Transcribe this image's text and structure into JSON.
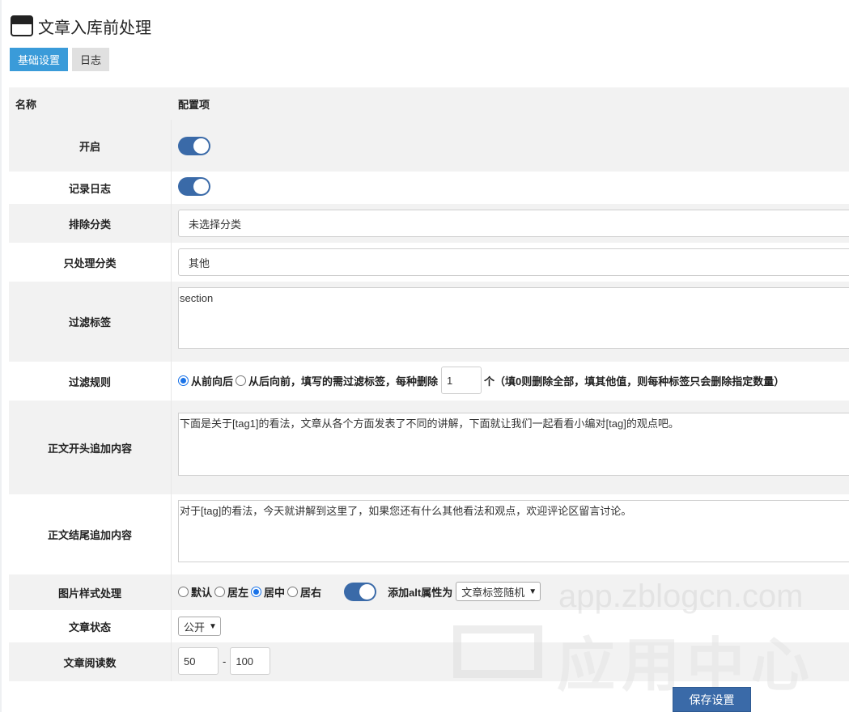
{
  "page": {
    "title": "文章入库前处理",
    "title_icon": "window-icon"
  },
  "tabs": [
    {
      "label": "基础设置",
      "active": true
    },
    {
      "label": "日志",
      "active": false
    }
  ],
  "table": {
    "col_name": "名称",
    "col_value": "配置项",
    "enable": {
      "label": "开启",
      "on": true
    },
    "log": {
      "label": "记录日志",
      "on": true
    },
    "exclude_category": {
      "label": "排除分类",
      "value": "未选择分类"
    },
    "only_category": {
      "label": "只处理分类",
      "value": "其他"
    },
    "filter_tags": {
      "label": "过滤标签",
      "value": "section"
    },
    "filter_rule": {
      "label": "过滤规则",
      "opt_front": "从前向后",
      "opt_back": "从后向前",
      "text_before": "，填写的需过滤标签，每种删除",
      "count": "1",
      "text_after": "个（填0则删除全部，填其他值，则每种标签只会删除指定数量）"
    },
    "prepend": {
      "label": "正文开头追加内容",
      "value": "下面是关于[tag1]的看法，文章从各个方面发表了不同的讲解，下面就让我们一起看看小编对[tag]的观点吧。"
    },
    "append": {
      "label": "正文结尾追加内容",
      "value": "对于[tag]的看法，今天就讲解到这里了，如果您还有什么其他看法和观点，欢迎评论区留言讨论。"
    },
    "image_style": {
      "label": "图片样式处理",
      "opt_default": "默认",
      "opt_left": "居左",
      "opt_center": "居中",
      "opt_right": "居右",
      "selected": "居中",
      "alt_on": true,
      "alt_label": "添加alt属性为",
      "alt_select": "文章标签随机"
    },
    "status": {
      "label": "文章状态",
      "value": "公开"
    },
    "views": {
      "label": "文章阅读数",
      "min": "50",
      "sep": "-",
      "max": "100"
    }
  },
  "save_label": "保存设置",
  "watermark": {
    "url": "app.zblogcn.com",
    "cn": "应用中心"
  },
  "colors": {
    "accent": "#3a9bd9",
    "switch": "#3a6aa8",
    "row_gray": "#f2f2f2"
  }
}
